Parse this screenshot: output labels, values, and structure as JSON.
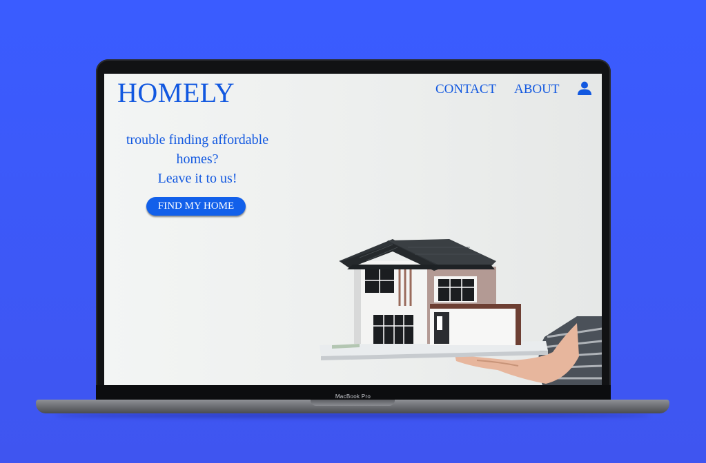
{
  "site": {
    "logo": "HOMELY",
    "nav": {
      "contact": "CONTACT",
      "about": "ABOUT"
    },
    "icons": {
      "account": "user-icon"
    },
    "hero": {
      "line1": "trouble finding affordable",
      "line2": "homes?",
      "line3": "Leave it to us!",
      "cta": "FIND MY HOME"
    },
    "colors": {
      "brand": "#1258e0",
      "button": "#1260ea",
      "background": "#3f55f0"
    }
  },
  "device": {
    "label": "MacBook Pro"
  }
}
